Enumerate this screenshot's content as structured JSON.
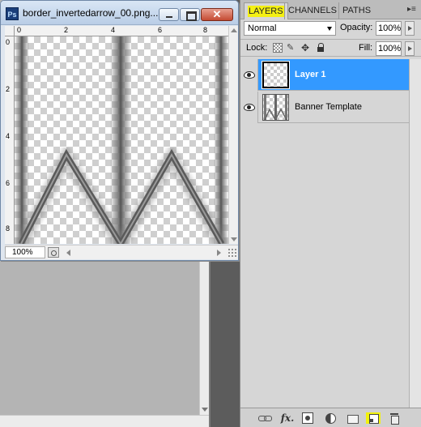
{
  "document": {
    "app_icon_text": "Ps",
    "title": "border_invertedarrow_00.png...",
    "zoom": "100%",
    "ruler_h_labels": [
      "0",
      "2",
      "4",
      "6",
      "8"
    ],
    "ruler_v_labels": [
      "0",
      "2",
      "4",
      "6",
      "8"
    ]
  },
  "panel": {
    "tabs": [
      {
        "label": "LAYERS",
        "active": true,
        "highlight": "#f4f012"
      },
      {
        "label": "CHANNELS",
        "active": false
      },
      {
        "label": "PATHS",
        "active": false
      }
    ],
    "menu_icon": "panel-menu-icon",
    "blend_mode": "Normal",
    "opacity_label": "Opacity:",
    "opacity_value": "100%",
    "lock_label": "Lock:",
    "fill_label": "Fill:",
    "fill_value": "100%",
    "layers": [
      {
        "name": "Layer 1",
        "selected": true,
        "visible": true
      },
      {
        "name": "Banner Template",
        "selected": false,
        "visible": true
      }
    ],
    "selection_color": "#3399ff",
    "bottom_icons": [
      "link-layers-icon",
      "fx-icon",
      "layer-mask-icon",
      "adjustment-layer-icon",
      "group-folder-icon",
      "new-layer-icon",
      "trash-icon"
    ],
    "new_layer_highlight": "#f2f20c"
  }
}
